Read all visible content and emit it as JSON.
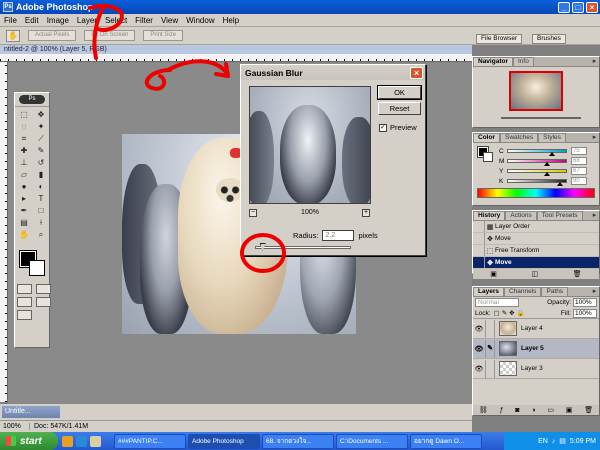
{
  "window": {
    "title": "Adobe Photoshop"
  },
  "menu": [
    "File",
    "Edit",
    "Image",
    "Layer",
    "Select",
    "Filter",
    "View",
    "Window",
    "Help"
  ],
  "options_bar": {
    "buttons": [
      "Actual Pixels",
      "Fit On Screen",
      "Print Size"
    ]
  },
  "palette_well": {
    "tabs": [
      "File Browser",
      "Brushes"
    ]
  },
  "document": {
    "tab_title": "ntitled-2 @ 100% (Layer 5, RGB)"
  },
  "dialog": {
    "title": "Gaussian Blur",
    "ok": "OK",
    "reset": "Reset",
    "preview_label": "Preview",
    "preview_checked": "✓",
    "zoom": "100%",
    "zoom_out": "−",
    "zoom_in": "+",
    "radius_label": "Radius:",
    "radius_value": "2.2",
    "radius_unit": "pixels",
    "radius_slider_fraction": 0.08
  },
  "navigator": {
    "tabs": [
      "Navigator",
      "Info"
    ]
  },
  "color": {
    "tabs": [
      "Color",
      "Swatches",
      "Styles"
    ],
    "sliders": [
      {
        "label": "C",
        "value": "75",
        "color": "#00a0c8",
        "fraction": 0.75
      },
      {
        "label": "M",
        "value": "68",
        "color": "#c80078",
        "fraction": 0.68
      },
      {
        "label": "Y",
        "value": "67",
        "color": "#d8c800",
        "fraction": 0.67
      },
      {
        "label": "K",
        "value": "90",
        "color": "#202020",
        "fraction": 0.9
      }
    ]
  },
  "history": {
    "tabs": [
      "History",
      "Actions",
      "Tool Presets"
    ],
    "items": [
      "Layer Order",
      "Move",
      "Free Transform",
      "Move"
    ]
  },
  "layers": {
    "tabs": [
      "Layers",
      "Channels",
      "Paths"
    ],
    "blend_mode": "Normal",
    "opacity_label": "Opacity:",
    "opacity_value": "100%",
    "lock_label": "Lock:",
    "fill_label": "Fill:",
    "fill_value": "100%",
    "items": [
      {
        "name": "Layer 4"
      },
      {
        "name": "Layer 5"
      },
      {
        "name": "Layer 3"
      }
    ]
  },
  "minimized_doc": "Untitle...",
  "status": {
    "zoom": "100%",
    "doc_info": "Doc: 547K/1.41M"
  },
  "taskbar": {
    "start": "start",
    "tasks": [
      "###PANTIP.C...",
      "Adobe Photoshop",
      "68. จากดวงใจ...",
      "C:\\Documents ...",
      "อยากดู Dawn O..."
    ],
    "lang": "EN",
    "clock": "5:09 PM"
  }
}
